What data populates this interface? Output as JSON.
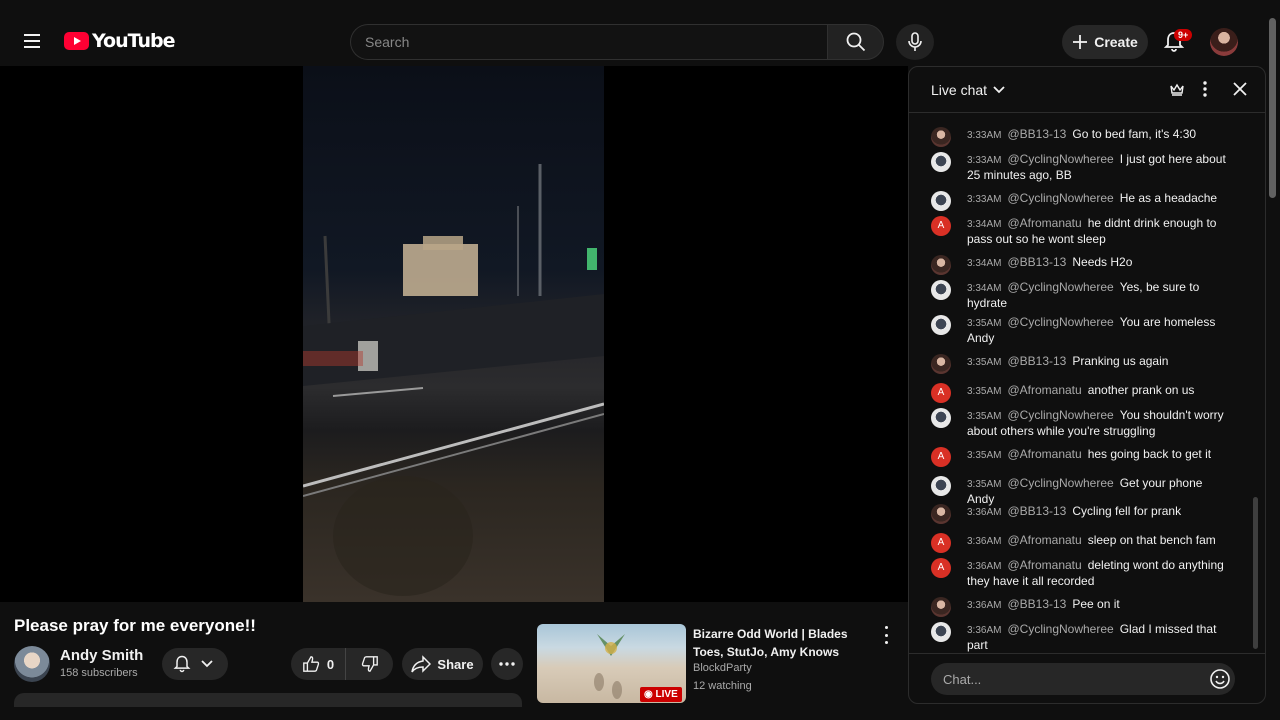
{
  "header": {
    "logo_text": "YouTube",
    "search_placeholder": "Search",
    "create_label": "Create",
    "notification_badge": "9+"
  },
  "video": {
    "title": "Please pray for me everyone!!",
    "channel": "Andy Smith",
    "subscribers": "158 subscribers",
    "like_count": "0",
    "share_label": "Share"
  },
  "recommendation": {
    "title": "Bizarre Odd World | Blades Toes, StutJo, Amy Knows",
    "channel": "BlockdParty",
    "watching": "12 watching",
    "badge": "LIVE"
  },
  "chat": {
    "title": "Live chat",
    "input_placeholder": "Chat...",
    "messages": [
      {
        "time": "3:33 AM",
        "author": "@BB13-13",
        "text": "Go to bed fam, it's 4:30",
        "avatar": "bb"
      },
      {
        "time": "3:33 AM",
        "author": "@CyclingNowheree",
        "text": "I just got here about 25 minutes ago, BB",
        "avatar": "cy"
      },
      {
        "time": "3:33 AM",
        "author": "@CyclingNowheree",
        "text": "He as a headache",
        "avatar": "cy"
      },
      {
        "time": "3:34 AM",
        "author": "@Afromanatu",
        "text": "he didnt drink enough to pass out so he wont sleep",
        "avatar": "af"
      },
      {
        "time": "3:34 AM",
        "author": "@BB13-13",
        "text": "Needs H2o",
        "avatar": "bb"
      },
      {
        "time": "3:34 AM",
        "author": "@CyclingNowheree",
        "text": "Yes, be sure to hydrate",
        "avatar": "cy"
      },
      {
        "time": "3:35 AM",
        "author": "@CyclingNowheree",
        "text": "You are homeless Andy",
        "avatar": "cy"
      },
      {
        "time": "3:35 AM",
        "author": "@BB13-13",
        "text": "Pranking us again",
        "avatar": "bb"
      },
      {
        "time": "3:35 AM",
        "author": "@Afromanatu",
        "text": "another prank on us",
        "avatar": "af"
      },
      {
        "time": "3:35 AM",
        "author": "@CyclingNowheree",
        "text": "You shouldn't worry about others while you're struggling",
        "avatar": "cy"
      },
      {
        "time": "3:35 AM",
        "author": "@Afromanatu",
        "text": "hes going back to get it",
        "avatar": "af"
      },
      {
        "time": "3:35 AM",
        "author": "@CyclingNowheree",
        "text": "Get your phone Andy",
        "avatar": "cy"
      },
      {
        "time": "3:36 AM",
        "author": "@BB13-13",
        "text": "Cycling fell for prank",
        "avatar": "bb"
      },
      {
        "time": "3:36 AM",
        "author": "@Afromanatu",
        "text": "sleep on that bench fam",
        "avatar": "af"
      },
      {
        "time": "3:36 AM",
        "author": "@Afromanatu",
        "text": "deleting wont do anything they have it all recorded",
        "avatar": "af"
      },
      {
        "time": "3:36 AM",
        "author": "@BB13-13",
        "text": "Pee on it",
        "avatar": "bb"
      },
      {
        "time": "3:36 AM",
        "author": "@CyclingNowheree",
        "text": "Glad I missed that part",
        "avatar": "cy"
      }
    ]
  },
  "icons": {
    "menu": "hamburger-icon",
    "search": "search-icon",
    "mic": "mic-icon",
    "plus": "plus-icon",
    "bell": "bell-icon",
    "like": "thumbs-up-icon",
    "dislike": "thumbs-down-icon",
    "share": "share-icon",
    "more": "more-icon",
    "crown": "crown-icon",
    "close": "close-icon",
    "emoji": "emoji-icon"
  }
}
